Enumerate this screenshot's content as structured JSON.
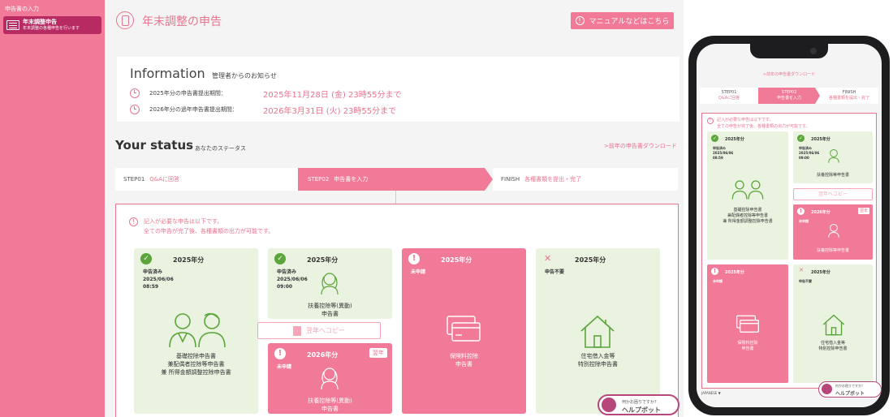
{
  "sidebar": {
    "section_label": "申告書の入力",
    "item_title": "年末調整申告",
    "item_sub": "年末調整の各種申告を行います"
  },
  "header": {
    "title": "年末調整の申告",
    "manual_label": "マニュアルなどはこちら"
  },
  "info": {
    "heading": "Information",
    "subheading": "管理者からのお知らせ",
    "rows": [
      {
        "label": "2025年分の申告書提出期間：",
        "value": "2025年11月28日 (金) 23時55分まで"
      },
      {
        "label": "2026年分の過年申告書提出期間：",
        "value": "2026年3月31日 (火) 23時55分まで"
      }
    ]
  },
  "status": {
    "heading": "Your status",
    "subheading": "あなたのステータス",
    "prev_download": ">前年の申告書ダウンロード"
  },
  "steps": [
    {
      "num": "STEP01",
      "label": "Q&Aに回答"
    },
    {
      "num": "STEP02",
      "label": "申告書を入力"
    },
    {
      "num": "FINISH",
      "label": "各種書類を提出・完了"
    }
  ],
  "notice": {
    "line1": "記入が必要な申告は以下です。",
    "line2": "全ての申告が完了後、各種書類の出力が可能です。"
  },
  "cards": {
    "c1": {
      "year": "2025年分",
      "status": "申告済み",
      "date": "2025/06/06",
      "time": "08:59",
      "names": [
        "基礎控除申告書",
        "兼配偶者控除等申告書",
        "兼 所得金額調整控除申告書"
      ]
    },
    "c2": {
      "year": "2025年分",
      "status": "申告済み",
      "date": "2025/06/06",
      "time": "09:00",
      "names": [
        "扶養控除等(異動)",
        "申告書"
      ]
    },
    "c3": {
      "year": "2025年分",
      "status": "未申請",
      "names": [
        "保険料控除",
        "申告書"
      ]
    },
    "c4": {
      "year": "2025年分",
      "status": "申告不要",
      "names": [
        "住宅借入金等",
        "特別控除申告書"
      ]
    },
    "c5": {
      "year": "2026年分",
      "status": "未申請",
      "badge": "翌年",
      "names": [
        "扶養控除等(異動)",
        "申告書"
      ]
    }
  },
  "copy_label": "翌年へコピー",
  "help": {
    "question": "何かお困りですか？",
    "title": "ヘルプボット"
  },
  "phone": {
    "prev_download": ">前年の申告書ダウンロード",
    "steps": [
      {
        "num": "STEP01",
        "label": "Q&Aに回答"
      },
      {
        "num": "STEP02",
        "label": "申告書を入力"
      },
      {
        "num": "FINISH",
        "label": "各種書類を提出・完了"
      }
    ],
    "notice": {
      "line1": "記入が必要な申告は以下です。",
      "line2": "全ての申告が完了後、各種書類の出力が可能です。"
    },
    "cards": {
      "c1": {
        "year": "2025年分",
        "status": "申告済み",
        "date": "2025/06/06",
        "time": "08:59",
        "names": [
          "基礎控除申告書",
          "兼配偶者控除等申告書",
          "兼 所得金額調整控除申告書"
        ]
      },
      "c2": {
        "year": "2025年分",
        "status": "申告済み",
        "date": "2025/06/06",
        "time": "09:00",
        "names": [
          "扶養控除等申告書"
        ]
      },
      "c5": {
        "year": "2026年分",
        "status": "未申請",
        "badge": "翌年",
        "names": [
          "扶養控除等申告書"
        ]
      },
      "c3": {
        "year": "2025年分",
        "status": "未申請",
        "names": [
          "保険料控除",
          "申告書"
        ]
      },
      "c4": {
        "year": "2025年分",
        "status": "申告不要",
        "names": [
          "住宅借入金等",
          "特別控除申告書"
        ]
      }
    },
    "copy_label": "翌年へコピー",
    "language": "JAPANESE ▼",
    "help": {
      "question": "何かお困りですか？",
      "title": "ヘルプボット"
    }
  },
  "colors": {
    "accent": "#f07a97",
    "sidebar_active": "#b82a62",
    "done_green": "#5ba53b",
    "card_green": "#eaf3e0"
  }
}
